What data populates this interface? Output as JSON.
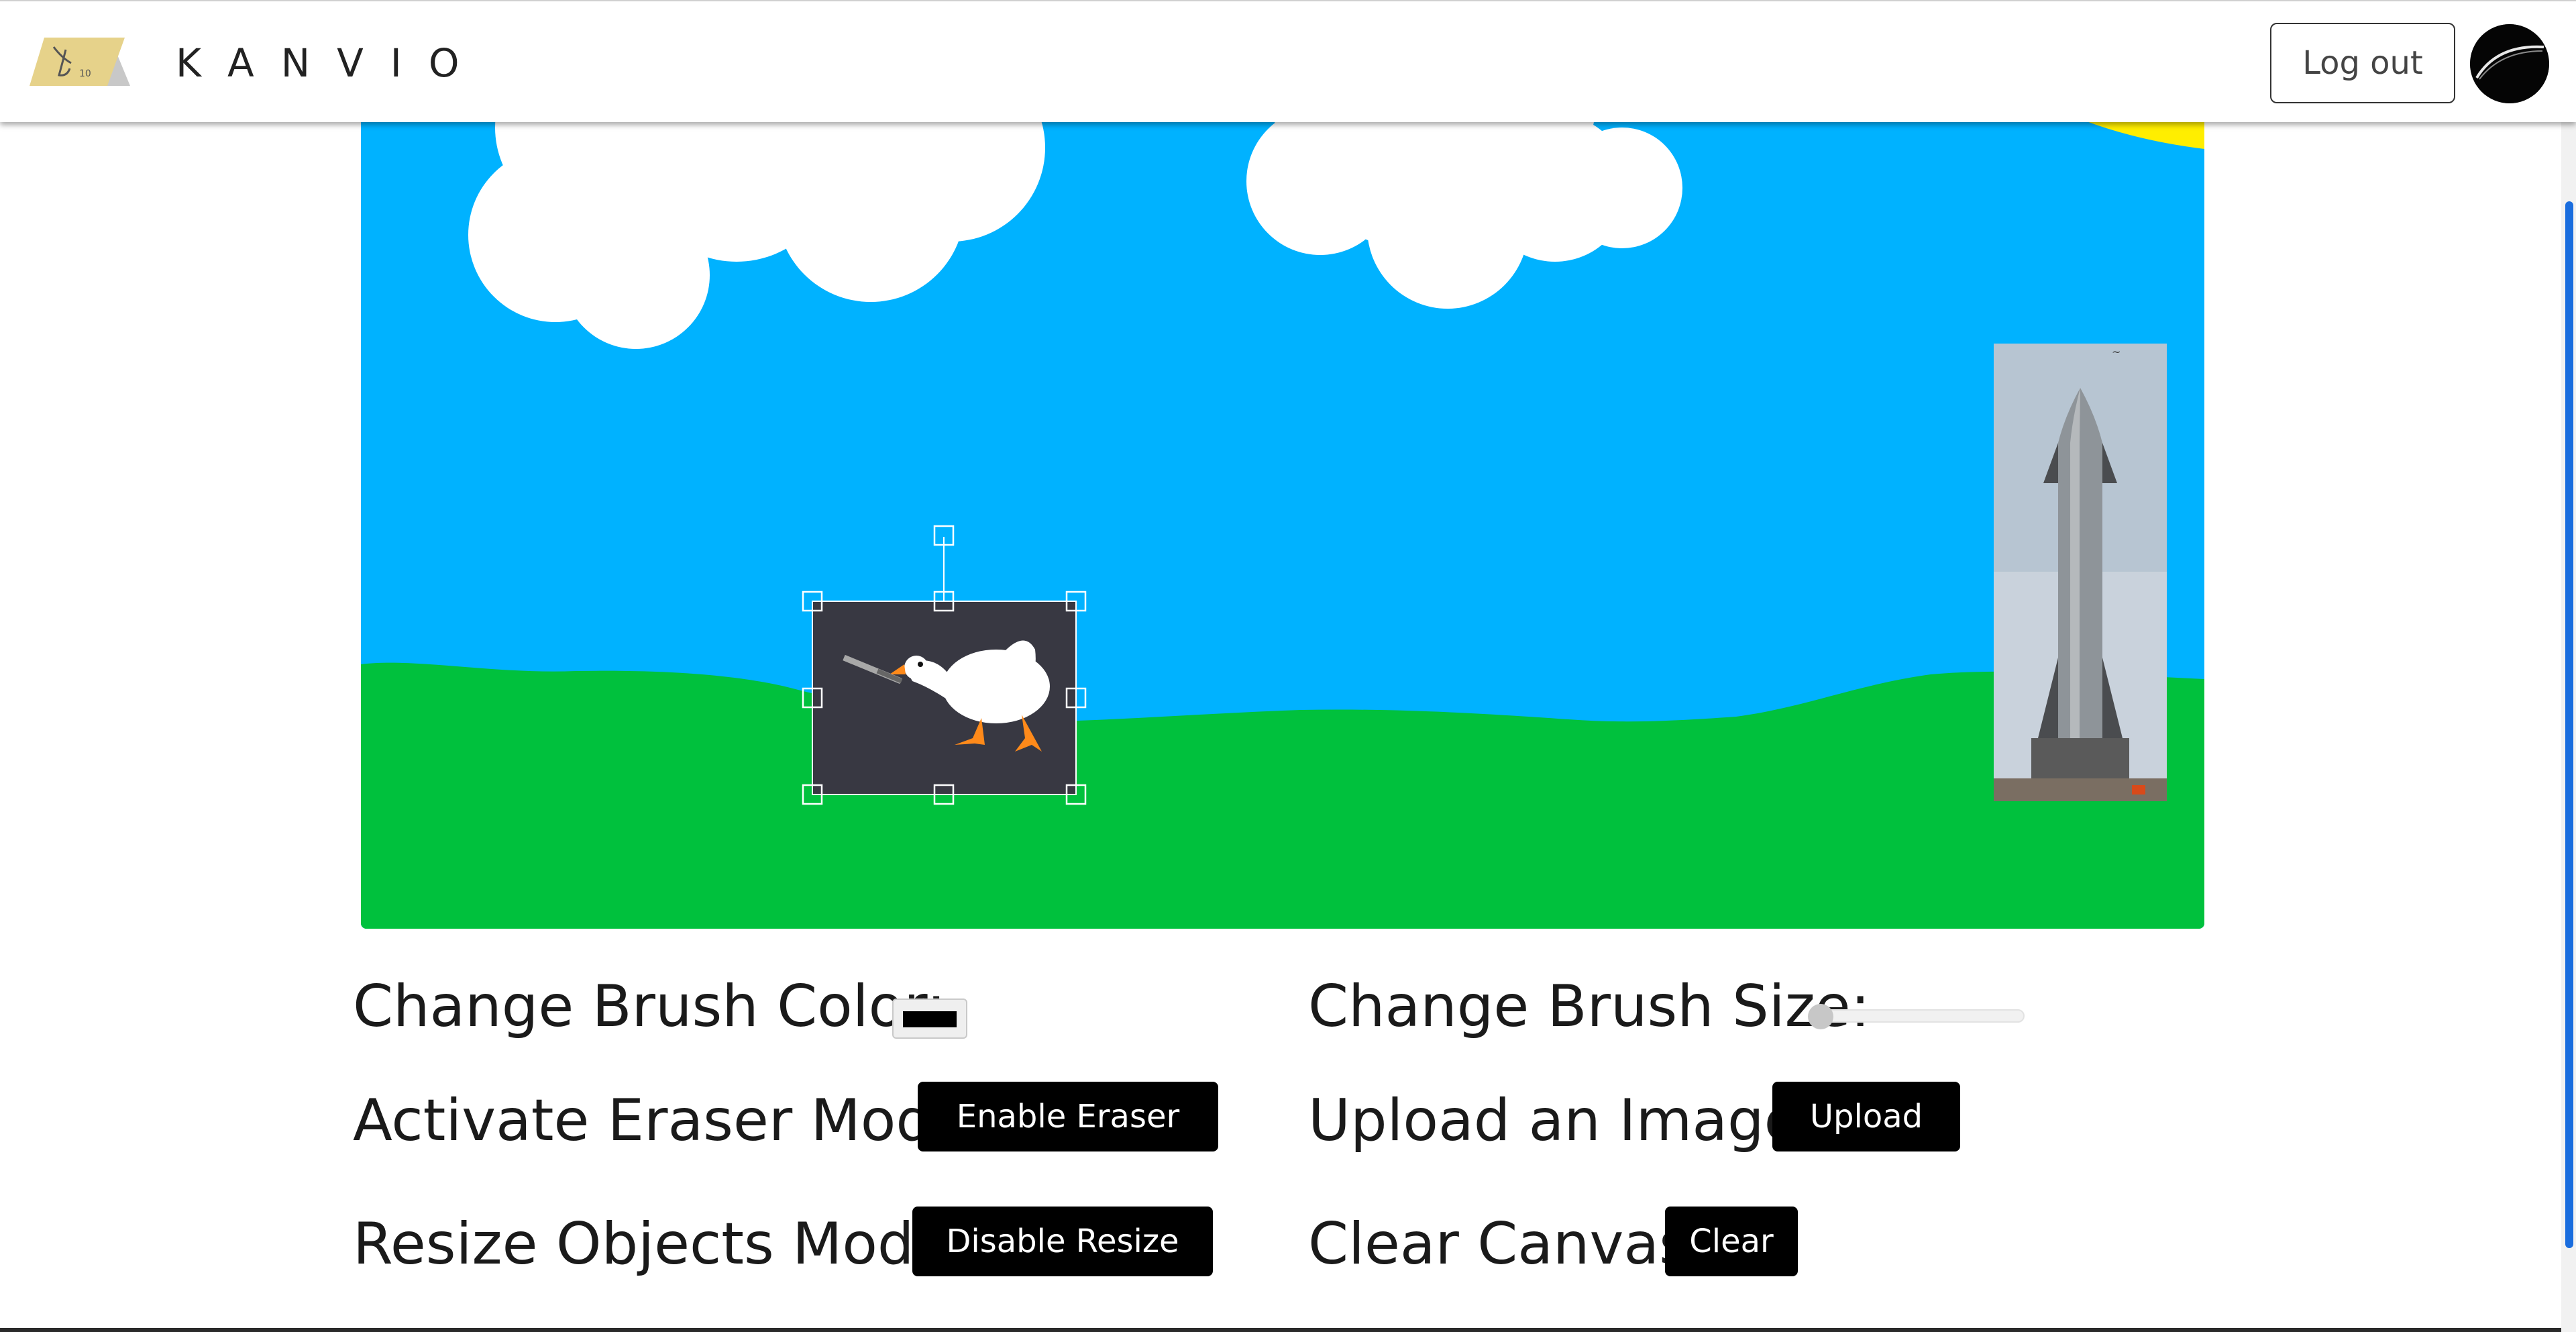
{
  "header": {
    "brand": "KANVIO",
    "logout_label": "Log out"
  },
  "controls": {
    "brush_color_label": "Change Brush Color:",
    "brush_color_value": "#000000",
    "brush_size_label": "Change Brush Size:",
    "brush_size_value": 0,
    "eraser_label": "Activate Eraser Mode:",
    "eraser_button": "Enable Eraser",
    "upload_label": "Upload an Image:",
    "upload_button": "Upload",
    "resize_label": "Resize Objects Mode:",
    "resize_button": "Disable Resize",
    "clear_label": "Clear Canvas:",
    "clear_button": "Clear"
  },
  "canvas": {
    "sky_color": "#00b2ff",
    "grass_color": "#00c13d",
    "sun_color": "#ffee00",
    "cloud_color": "#ffffff"
  },
  "icons": {
    "logo": "kanvio-logo-icon",
    "avatar": "user-avatar"
  }
}
